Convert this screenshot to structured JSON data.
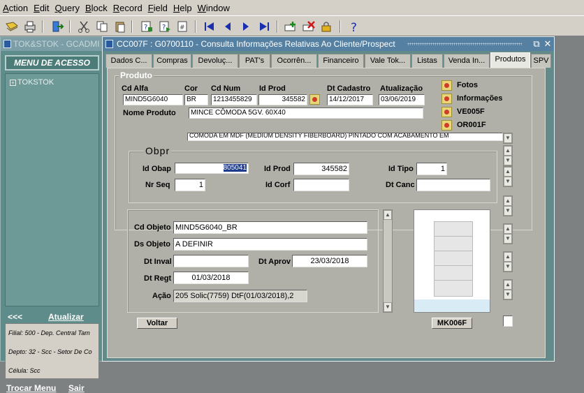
{
  "menubar": {
    "items": [
      "Action",
      "Edit",
      "Query",
      "Block",
      "Record",
      "Field",
      "Help",
      "Window"
    ],
    "mnemonics": [
      "A",
      "E",
      "Q",
      "B",
      "R",
      "F",
      "H",
      "W"
    ]
  },
  "toolbar": {
    "icons": [
      "save-icon",
      "print-icon",
      "exit-icon",
      "cut-icon",
      "copy-icon",
      "paste-icon",
      "enter-query-icon",
      "execute-query-icon",
      "count-query-icon",
      "first-record-icon",
      "previous-record-icon",
      "next-record-icon",
      "last-record-icon",
      "insert-record-icon",
      "delete-record-icon",
      "lock-record-icon",
      "help-icon"
    ]
  },
  "left_window": {
    "title": "TOK&STOK - GCADMI",
    "menu_header": "MENU DE ACESSO",
    "tree_node": "TOKSTOK",
    "back_label": "<<<",
    "update_label": "Atualizar",
    "info_lines": [
      "Filial: 500 - Dep. Central Tam",
      "Depto: 32 - Scc - Setor De Co",
      "Célula: Scc"
    ],
    "switch_menu_label": "Trocar Menu",
    "exit_label": "Sair"
  },
  "main_window": {
    "title": "CC007F : G0700110 - Consulta Informações Relativas Ao Cliente/Prospect",
    "controls": [
      "⧉",
      "✕"
    ],
    "tabs": [
      "Dados C...",
      "Compras",
      "Devoluç...",
      "PAT's",
      "Ocorrên...",
      "Financeiro",
      "Vale Tok...",
      "Listas",
      "Venda In...",
      "Produtos",
      "SPV"
    ],
    "active_tab": "Produtos"
  },
  "produto": {
    "group_label": "Produto",
    "labels": {
      "cd_alfa": "Cd Alfa",
      "cor": "Cor",
      "cd_num": "Cd Num",
      "id_prod": "Id Prod",
      "dt_cadastro": "Dt Cadastro",
      "atualizacao": "Atualização",
      "nome_produto": "Nome Produto"
    },
    "values": {
      "cd_alfa": "MIND5G6040",
      "cor": "BR",
      "cd_num": "1213455829",
      "id_prod": "345582",
      "dt_cadastro": "14/12/2017",
      "atualizacao": "03/06/2019",
      "nome_produto": "MINCE CÔMODA 5GV. 60X40",
      "descricao": "CÔMODA EM MDF (MEDIUM DENSITY FIBERBOARD) PINTADO COM ACABAMENTO EM"
    },
    "links": [
      "Fotos",
      "Informações",
      "VE005F",
      "OR001F"
    ]
  },
  "obpr": {
    "group_label": "Obpr",
    "labels": {
      "id_obap": "Id Obap",
      "id_prod": "Id Prod",
      "id_tipo": "Id Tipo",
      "nr_seq": "Nr Seq",
      "id_corf": "Id Corf",
      "dt_canc": "Dt Canc"
    },
    "values": {
      "id_obap": "805041",
      "id_prod": "345582",
      "id_tipo": "1",
      "nr_seq": "1",
      "id_corf": "",
      "dt_canc": ""
    }
  },
  "objeto": {
    "labels": {
      "cd_objeto": "Cd Objeto",
      "ds_objeto": "Ds Objeto",
      "dt_inval": "Dt Inval",
      "dt_aprov": "Dt Aprov",
      "dt_regt": "Dt Regt",
      "acao": "Ação"
    },
    "values": {
      "cd_objeto": "MIND5G6040_BR",
      "ds_objeto": "A DEFINIR",
      "dt_inval": "",
      "dt_aprov": "23/03/2018",
      "dt_regt": "01/03/2018",
      "acao": "205 Solic(7759) DtF(01/03/2018),2"
    }
  },
  "image_caption": "MK006F",
  "back_button": "Voltar"
}
